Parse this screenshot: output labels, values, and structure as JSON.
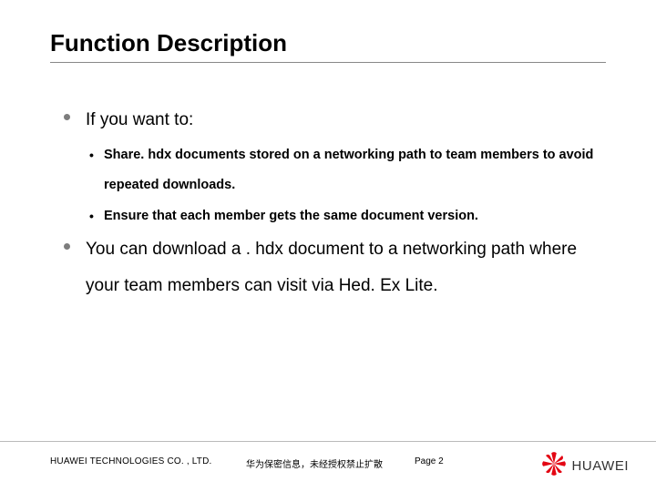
{
  "title": "Function Description",
  "body": {
    "items": [
      {
        "text": "If you want to:",
        "sub": [
          "Share. hdx documents stored on a networking path to team members to avoid repeated downloads.",
          "Ensure that each member gets the same document version."
        ]
      },
      {
        "text": "You can download a . hdx document to a networking path where your team members can visit via Hed. Ex Lite."
      }
    ]
  },
  "footer": {
    "company": "HUAWEI TECHNOLOGIES CO. , LTD.",
    "confidential": "华为保密信息，未经授权禁止扩散",
    "page_label": "Page 2",
    "logo_text": "HUAWEI"
  }
}
